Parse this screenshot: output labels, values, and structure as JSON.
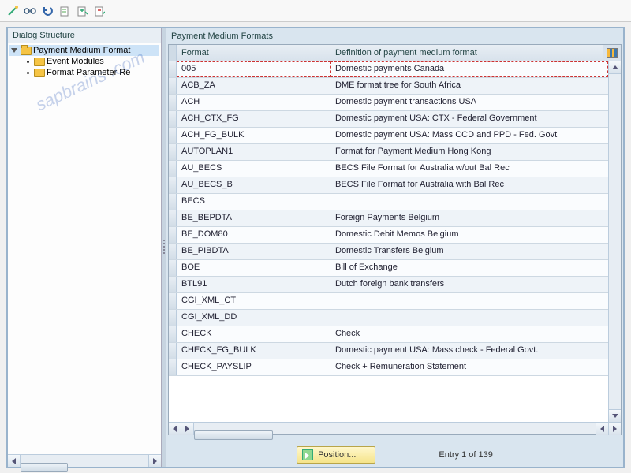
{
  "toolbar": {
    "icons": [
      "wand",
      "glasses",
      "undo",
      "doc-add",
      "doc-export",
      "doc-import"
    ]
  },
  "left": {
    "header": "Dialog Structure",
    "tree": [
      {
        "label": "Payment Medium Format",
        "level": 1,
        "selected": true,
        "open": true
      },
      {
        "label": "Event Modules",
        "level": 2
      },
      {
        "label": "Format Parameter Re",
        "level": 2
      }
    ]
  },
  "grid": {
    "title": "Payment Medium Formats",
    "columns": [
      "Format",
      "Definition of payment medium format"
    ],
    "rows": [
      {
        "format": "005",
        "def": "Domestic payments Canada",
        "selected": true
      },
      {
        "format": "ACB_ZA",
        "def": "DME format tree for South Africa"
      },
      {
        "format": "ACH",
        "def": "Domestic payment transactions USA"
      },
      {
        "format": "ACH_CTX_FG",
        "def": "Domestic payment USA: CTX - Federal Government"
      },
      {
        "format": "ACH_FG_BULK",
        "def": "Domestic payment USA: Mass CCD and PPD - Fed. Govt"
      },
      {
        "format": "AUTOPLAN1",
        "def": "Format for Payment Medium Hong Kong"
      },
      {
        "format": "AU_BECS",
        "def": "BECS File Format for Australia w/out Bal Rec"
      },
      {
        "format": "AU_BECS_B",
        "def": "BECS File Format for Australia with Bal Rec"
      },
      {
        "format": "BECS",
        "def": ""
      },
      {
        "format": "BE_BEPDTA",
        "def": "Foreign Payments Belgium"
      },
      {
        "format": "BE_DOM80",
        "def": "Domestic Debit Memos Belgium"
      },
      {
        "format": "BE_PIBDTA",
        "def": "Domestic Transfers Belgium"
      },
      {
        "format": "BOE",
        "def": "Bill of Exchange"
      },
      {
        "format": "BTL91",
        "def": "Dutch foreign bank transfers"
      },
      {
        "format": "CGI_XML_CT",
        "def": ""
      },
      {
        "format": "CGI_XML_DD",
        "def": ""
      },
      {
        "format": "CHECK",
        "def": "Check"
      },
      {
        "format": "CHECK_FG_BULK",
        "def": "Domestic payment USA: Mass check - Federal Govt."
      },
      {
        "format": "CHECK_PAYSLIP",
        "def": "Check + Remuneration Statement"
      }
    ]
  },
  "footer": {
    "position_label": "Position...",
    "entry_label": "Entry 1 of 139"
  },
  "watermark": "sapbrains    .com"
}
